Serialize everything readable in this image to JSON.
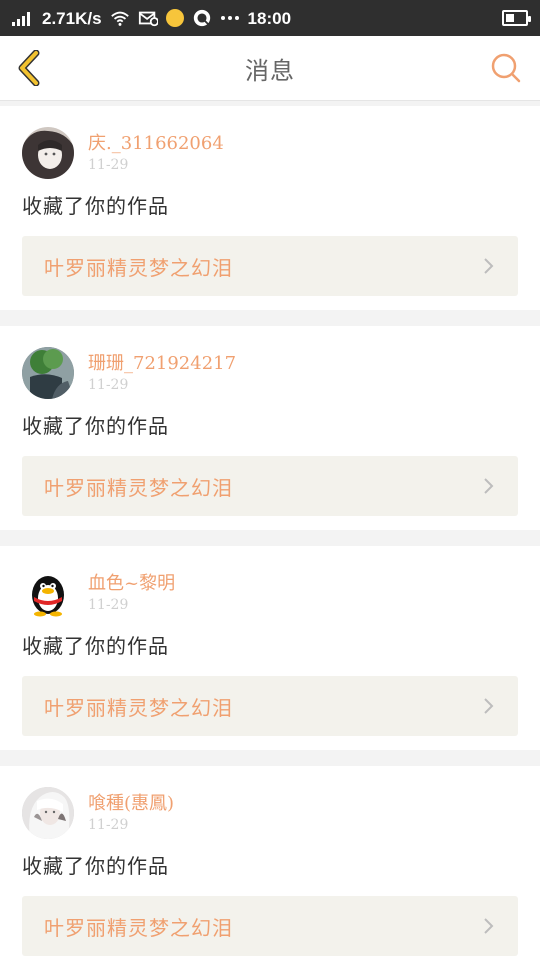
{
  "status_bar": {
    "speed": "2.71K/s",
    "time": "18:00",
    "icons": [
      "signal-icon",
      "wifi-icon",
      "mail-icon",
      "yellow-dot-icon",
      "chat-icon",
      "more-icon",
      "battery-icon"
    ],
    "battery_level": 0.45
  },
  "header": {
    "title": "消息",
    "back_icon": "chevron-left-icon",
    "search_icon": "search-icon"
  },
  "messages": [
    {
      "username": "庆._311662064",
      "time": "11-29",
      "action": "收藏了你的作品",
      "work_title": "叶罗丽精灵梦之幻泪"
    },
    {
      "username": "珊珊_721924217",
      "time": "11-29",
      "action": "收藏了你的作品",
      "work_title": "叶罗丽精灵梦之幻泪"
    },
    {
      "username": "血色~黎明",
      "time": "11-29",
      "action": "收藏了你的作品",
      "work_title": "叶罗丽精灵梦之幻泪"
    },
    {
      "username": "喰種(惠鳳)",
      "time": "11-29",
      "action": "收藏了你的作品",
      "work_title": "叶罗丽精灵梦之幻泪"
    }
  ],
  "colors": {
    "accent_orange": "#f0a070",
    "back_yellow": "#f2c230",
    "status_bar_bg": "#2f2f2f",
    "card_link_bg": "#f3f2ec"
  }
}
